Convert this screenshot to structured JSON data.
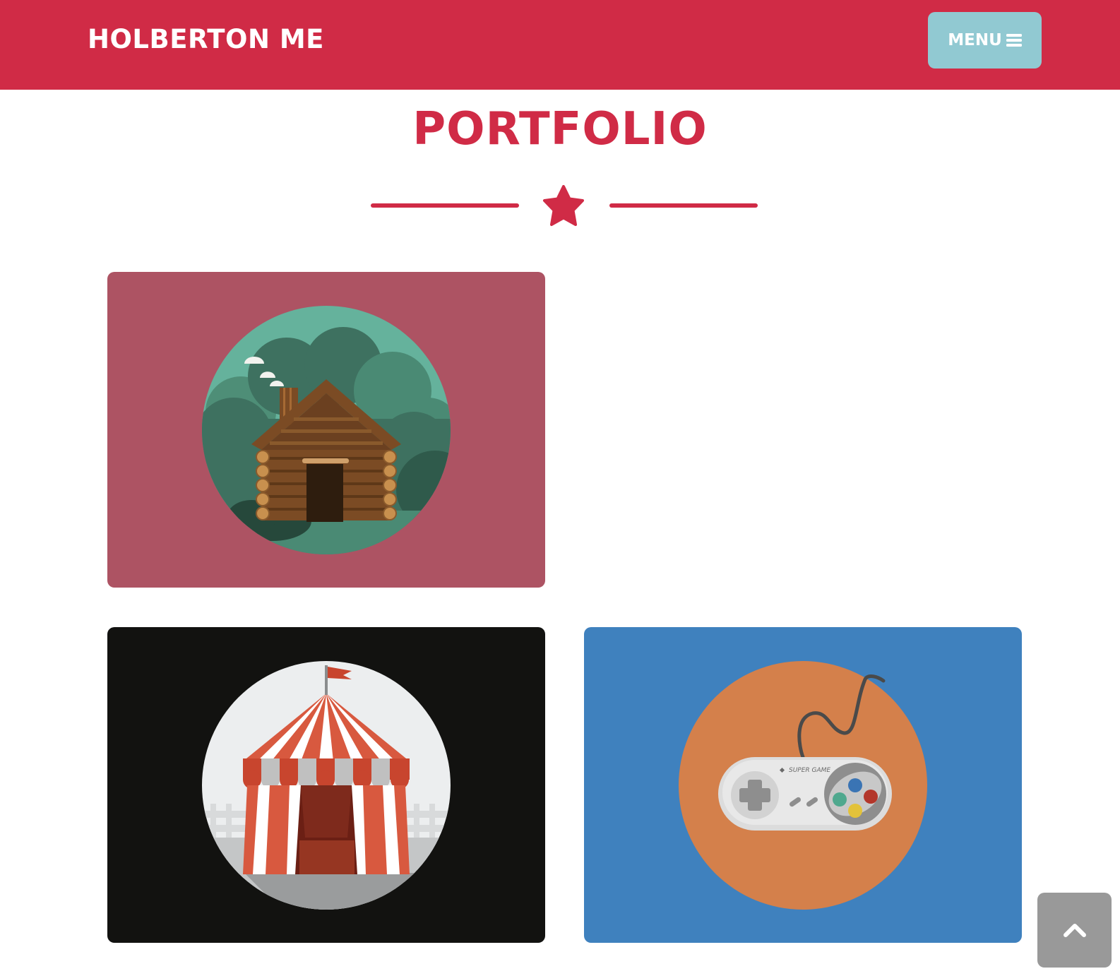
{
  "navbar": {
    "brand": "HOLBERTON ME",
    "menu_label": "MENU",
    "background_color": "#d02b46",
    "menu_button_color": "#91c9d2"
  },
  "portfolio": {
    "title": "PORTFOLIO",
    "divider_icon": "star-icon",
    "accent_color": "#d02b46",
    "items": [
      {
        "name": "log-cabin",
        "background_color": "#ad5363",
        "circle_color": "#65b29c"
      },
      {
        "name": "circus-tent",
        "background_color": "#121210",
        "circle_color": "#eceeef"
      },
      {
        "name": "game-controller",
        "background_color": "#3f81be",
        "circle_color": "#d4804b",
        "controller_text": "SUPER GAME"
      }
    ]
  },
  "scroll_top": {
    "icon": "chevron-up-icon",
    "color": "#999999"
  }
}
